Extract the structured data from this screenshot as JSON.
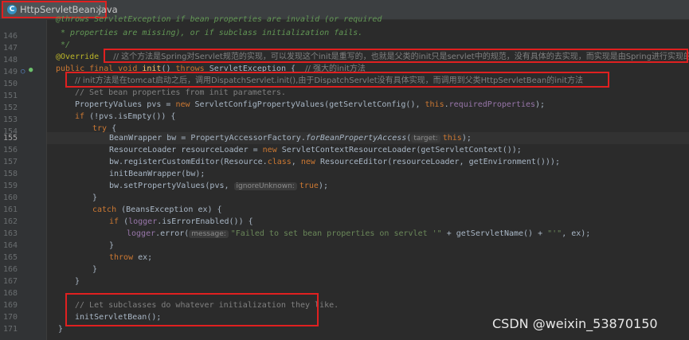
{
  "tab": {
    "filename": "HttpServletBean.java",
    "icon": "C",
    "close": "×"
  },
  "gutter": {
    "lines": [
      "146",
      "147",
      "148",
      "149",
      "150",
      "151",
      "152",
      "153",
      "154",
      "155",
      "156",
      "157",
      "158",
      "159",
      "160",
      "161",
      "162",
      "163",
      "164",
      "165",
      "166",
      "167",
      "168",
      "169",
      "170",
      "171"
    ],
    "current_line": "155"
  },
  "code": {
    "l145": "@throws ServletException if bean properties are invalid (or required",
    "l146": " * properties are missing), or if subclass initialization fails.",
    "l147": " */",
    "l148_ann": "@Override",
    "l148_cmt": "// 这个方法是Spring对Servlet规范的实现，可以发现这个init是重写的，也就是父类的init只是servlet中的规范，没有具体的去实现，而实现是由Spring进行实现的",
    "l149_kw": "public final void ",
    "l149_name": "init",
    "l149_mid": "() ",
    "l149_throws": "throws ",
    "l149_exc": "ServletException {  ",
    "l149_cmt": "// 强大的init方法",
    "l150_cmt": "// init方法是在tomcat启动之后，调用DispatchServlet.init(),由于DispatchServlet没有具体实现，而调用到父类HttpServletBean的init方法",
    "l151_cmt": "// Set bean properties from init parameters.",
    "l152_a": "PropertyValues pvs = ",
    "l152_new": "new ",
    "l152_b": "ServletConfigPropertyValues(getServletConfig(), ",
    "l152_this": "this",
    "l152_c": ".",
    "l152_field": "requiredProperties",
    "l152_d": ");",
    "l153_if": "if ",
    "l153_rest": "(!pvs.isEmpty()) {",
    "l154_try": "try ",
    "l154_rest": "{",
    "l155_a": "BeanWrapper bw = PropertyAccessorFactory.",
    "l155_m": "forBeanPropertyAccess",
    "l155_b": "(",
    "l155_hint": "target:",
    "l155_this": "this",
    "l155_c": ");",
    "l156_a": "ResourceLoader resourceLoader = ",
    "l156_new": "new ",
    "l156_b": "ServletContextResourceLoader(getServletContext());",
    "l157_a": "bw.registerCustomEditor(Resource.",
    "l157_class": "class",
    "l157_b": ", ",
    "l157_new": "new ",
    "l157_c": "ResourceEditor(resourceLoader, getEnvironment()));",
    "l158": "initBeanWrapper(bw);",
    "l159_a": "bw.setPropertyValues(pvs, ",
    "l159_hint": "ignoreUnknown:",
    "l159_true": "true",
    "l159_b": ");",
    "l160": "}",
    "l161_catch": "catch ",
    "l161_rest": "(BeansException ex) {",
    "l162_if": "if ",
    "l162_a": "(",
    "l162_field": "logger",
    "l162_b": ".isErrorEnabled()) {",
    "l163_field": "logger",
    "l163_a": ".error(",
    "l163_hint": "message:",
    "l163_str": "\"Failed to set bean properties on servlet '\"",
    "l163_b": " + getServletName() + ",
    "l163_str2": "\"'\"",
    "l163_c": ", ex);",
    "l164": "}",
    "l165_throw": "throw ",
    "l165_rest": "ex;",
    "l166": "}",
    "l167": "}",
    "l169_cmt": "// Let subclasses do whatever initialization they like.",
    "l170": "initServletBean();",
    "l171": "}"
  },
  "watermark": "CSDN @weixin_53870150",
  "colors": {
    "annotation_box": "#e02020",
    "background": "#2b2b2b",
    "keyword": "#cc7832",
    "comment": "#808080"
  }
}
